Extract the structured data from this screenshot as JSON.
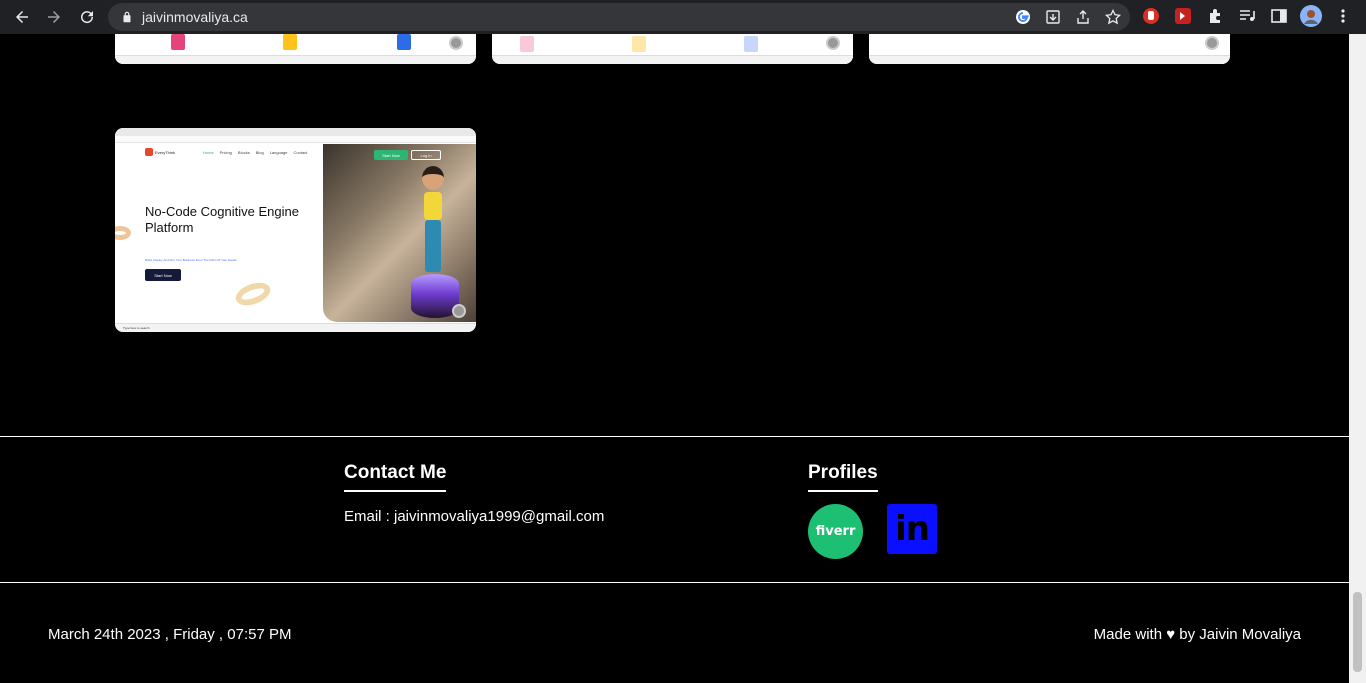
{
  "browser": {
    "url": "jaivinmovaliya.ca",
    "accent": "#202124"
  },
  "gallery": {
    "showcase": {
      "headline": "No-Code Cognitive Engine Platform",
      "subtitle": "Build, Deploy And Run Your Business From The Palm Of Your Hands",
      "logo_text": "EveryThink",
      "nav_links": [
        "Home",
        "Pricing",
        "Blocks",
        "Blog",
        "Language",
        "Contact"
      ],
      "start_now": "Start Now",
      "log_in": "Log In",
      "search_placeholder": "Type here to search"
    }
  },
  "footer": {
    "contact_heading": "Contact Me",
    "email_text": "Email : jaivinmovaliya1999@gmail.com",
    "profiles_heading": "Profiles",
    "fiverr_label": "fiverr",
    "linkedin_label": "in",
    "datetime": "March 24th 2023 , Friday , 07:57 PM",
    "made_with": "Made with ♥ by Jaivin Movaliya"
  },
  "colors": {
    "fiverr": "#1dbf73",
    "linkedin": "#0a10ff",
    "background": "#000000"
  }
}
